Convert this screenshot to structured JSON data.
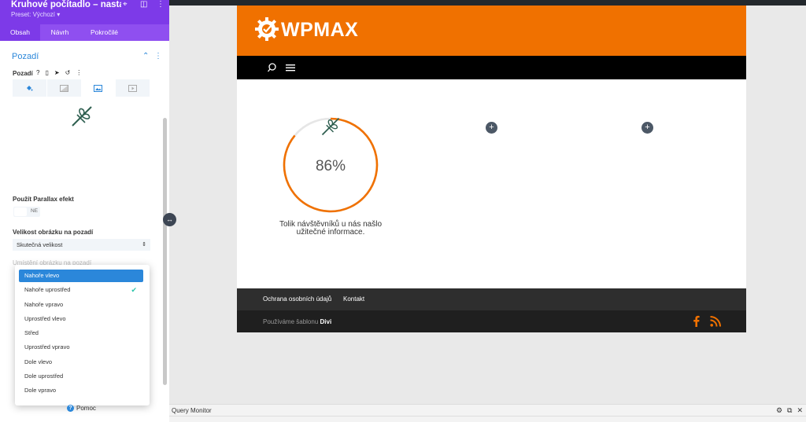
{
  "panel": {
    "title": "Kruhové počítadlo – nastav...",
    "preset": "Preset: Výchozí ▾",
    "tabs": [
      {
        "label": "Obsah",
        "active": true
      },
      {
        "label": "Návrh",
        "active": false
      },
      {
        "label": "Pokročilé",
        "active": false
      }
    ],
    "section_title": "Pozadí",
    "background_label": "Pozadí",
    "help_glyph": "?",
    "parallax_label": "Použít Parallax efekt",
    "parallax_toggle": "NE",
    "image_size_label": "Velikost obrázku na pozadí",
    "image_size_value": "Skutečná velikost",
    "position_label": "Umístění obrázku na pozadí",
    "dropdown_options": [
      {
        "label": "Nahoře vlevo",
        "highlighted": true
      },
      {
        "label": "Nahoře uprostřed",
        "checked": true
      },
      {
        "label": "Nahoře vpravo"
      },
      {
        "label": "Uprostřed vlevo"
      },
      {
        "label": "Střed"
      },
      {
        "label": "Uprostřed vpravo"
      },
      {
        "label": "Dole vlevo"
      },
      {
        "label": "Dole uprostřed"
      },
      {
        "label": "Dole vpravo"
      }
    ],
    "help_label": "Pomoc"
  },
  "site": {
    "logo": "WPMAX",
    "counter": {
      "percent": 86,
      "label": "86%",
      "text": "Tolik návštěvníků u nás našlo užitečné informace."
    },
    "footer_links": [
      "Ochrana osobních údajů",
      "Kontakt"
    ],
    "credits_prefix": "Používáme šablonu",
    "credits_theme": "Divi"
  },
  "query_monitor": {
    "title": "Query Monitor"
  },
  "colors": {
    "purple": "#7d3ae8",
    "blue": "#2b87da",
    "orange": "#f07100",
    "teal": "#29c4a9"
  }
}
